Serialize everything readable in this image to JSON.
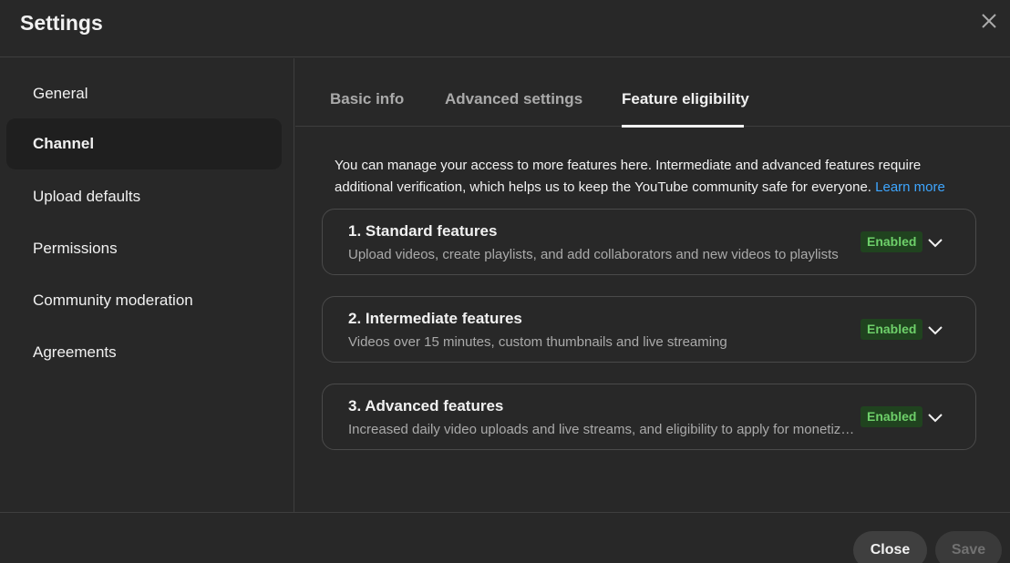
{
  "dialog": {
    "title": "Settings",
    "close_icon": "close-icon"
  },
  "sidebar": {
    "items": [
      {
        "label": "General",
        "active": false
      },
      {
        "label": "Channel",
        "active": true
      },
      {
        "label": "Upload defaults",
        "active": false
      },
      {
        "label": "Permissions",
        "active": false
      },
      {
        "label": "Community moderation",
        "active": false
      },
      {
        "label": "Agreements",
        "active": false
      }
    ]
  },
  "tabs": [
    {
      "label": "Basic info",
      "active": false
    },
    {
      "label": "Advanced settings",
      "active": false
    },
    {
      "label": "Feature eligibility",
      "active": true
    }
  ],
  "intro": {
    "text": "You can manage your access to more features here. Intermediate and advanced features require additional verification, which helps us to keep the YouTube community safe for everyone.",
    "link": "Learn more"
  },
  "features": [
    {
      "title": "1. Standard features",
      "description": "Upload videos, create playlists, and add collaborators and new videos to playlists",
      "status": "Enabled"
    },
    {
      "title": "2. Intermediate features",
      "description": "Videos over 15 minutes, custom thumbnails and live streaming",
      "status": "Enabled"
    },
    {
      "title": "3. Advanced features",
      "description": "Increased daily video uploads and live streams, and eligibility to apply for monetization",
      "status": "Enabled"
    }
  ],
  "footer": {
    "close_label": "Close",
    "save_label": "Save"
  },
  "colors": {
    "background": "#282828",
    "accent_link": "#3ea6ff",
    "badge_bg": "#20431f",
    "badge_text": "#6ed06a"
  }
}
